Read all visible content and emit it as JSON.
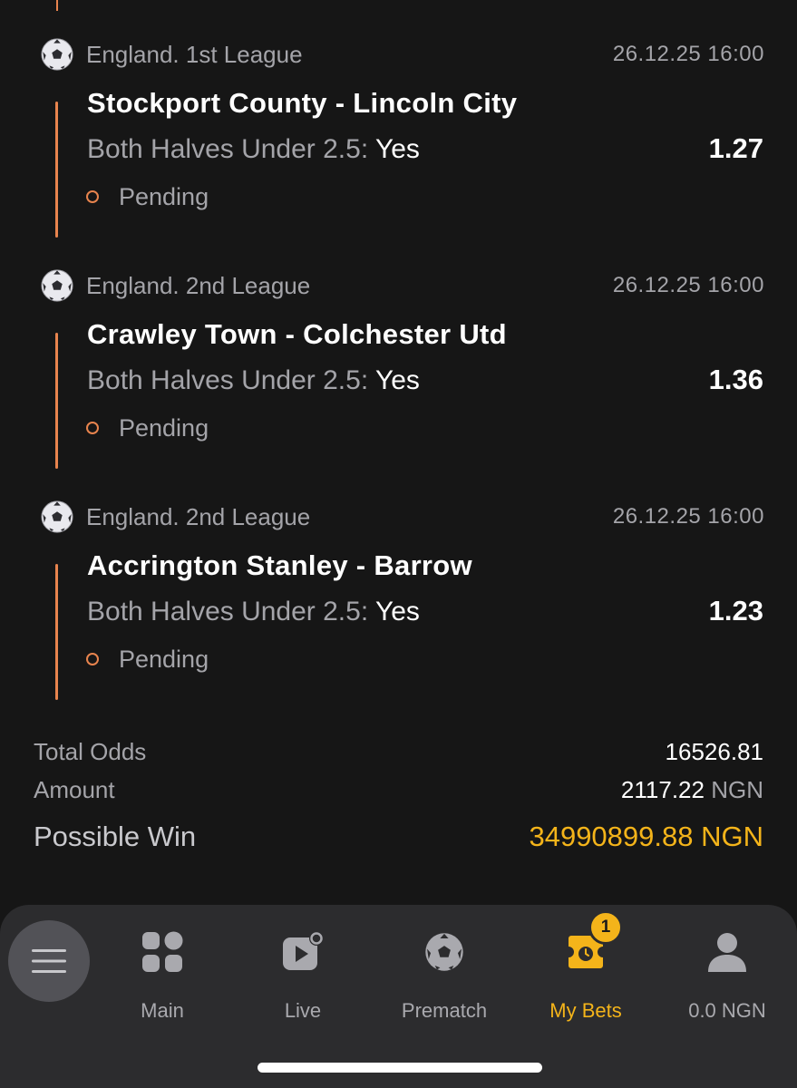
{
  "bets": [
    {
      "league": "England. 1st League",
      "datetime": "26.12.25 16:00",
      "match": "Stockport County - Lincoln City",
      "market": "Both Halves Under 2.5: ",
      "pick": "Yes",
      "odd": "1.27",
      "status": "Pending"
    },
    {
      "league": "England. 2nd League",
      "datetime": "26.12.25 16:00",
      "match": "Crawley Town - Colchester Utd",
      "market": "Both Halves Under 2.5: ",
      "pick": "Yes",
      "odd": "1.36",
      "status": "Pending"
    },
    {
      "league": "England. 2nd League",
      "datetime": "26.12.25 16:00",
      "match": "Accrington Stanley - Barrow",
      "market": "Both Halves Under 2.5: ",
      "pick": "Yes",
      "odd": "1.23",
      "status": "Pending"
    }
  ],
  "summary": {
    "total_odds_label": "Total Odds",
    "total_odds_value": "16526.81",
    "amount_label": "Amount",
    "amount_value": "2117.22",
    "amount_currency": "NGN",
    "possible_win_label": "Possible Win",
    "possible_win_value": "34990899.88 NGN"
  },
  "tabbar": {
    "items": [
      {
        "label": "Main",
        "icon": "grid-icon"
      },
      {
        "label": "Live",
        "icon": "live-video-icon"
      },
      {
        "label": "Prematch",
        "icon": "soccer-ball-icon"
      },
      {
        "label": "My Bets",
        "icon": "ticket-clock-icon",
        "badge": "1",
        "active": true
      },
      {
        "label": "0.0 NGN",
        "icon": "user-icon"
      }
    ]
  },
  "colors": {
    "background": "#161616",
    "accent_orange": "#e8844e",
    "accent_yellow": "#f4b41a",
    "muted_text": "#a4a4a9",
    "tabbar_bg": "#2c2c2e"
  }
}
